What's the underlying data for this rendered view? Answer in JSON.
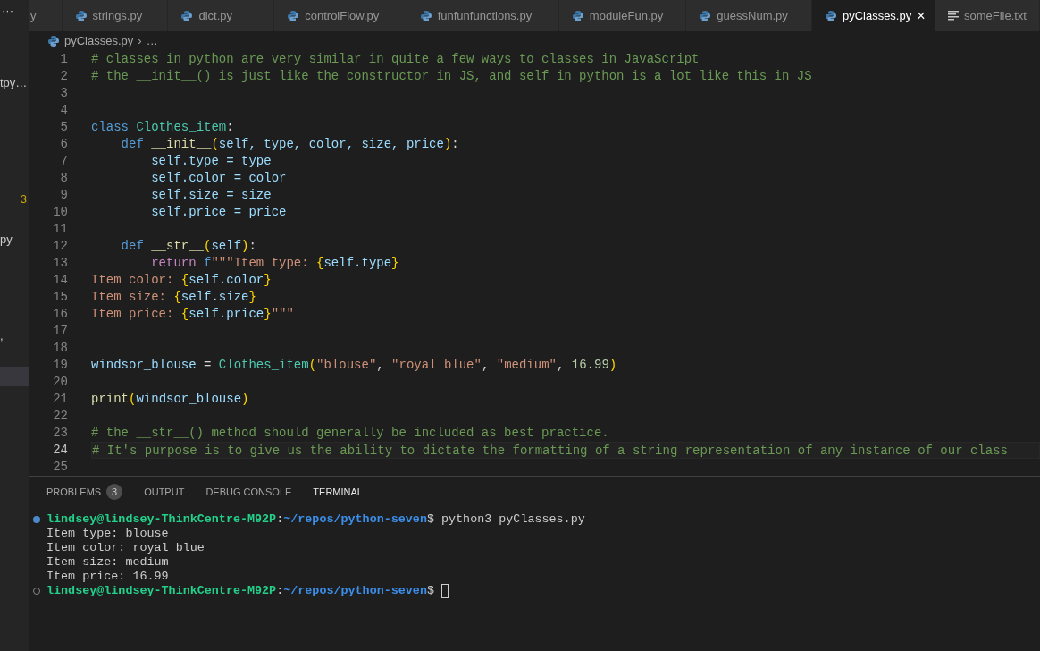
{
  "sidebar": {
    "more": "···",
    "items": [
      {
        "text": "tpy…",
        "kind": "file",
        "selected": false
      },
      {
        "text": "3",
        "kind": "count",
        "selected": false
      },
      {
        "text": "py",
        "kind": "file",
        "selected": false
      },
      {
        "text": ",",
        "kind": "file",
        "selected": false
      },
      {
        "kind": "file",
        "selected": true
      }
    ]
  },
  "tabs": [
    {
      "label": "y",
      "selected": false,
      "cut": true
    },
    {
      "label": "strings.py",
      "kind": "python",
      "selected": false
    },
    {
      "label": "dict.py",
      "kind": "python",
      "selected": false
    },
    {
      "label": "controlFlow.py",
      "kind": "python",
      "selected": false
    },
    {
      "label": "funfunfunctions.py",
      "kind": "python",
      "selected": false
    },
    {
      "label": "moduleFun.py",
      "kind": "python",
      "selected": false
    },
    {
      "label": "guessNum.py",
      "kind": "python",
      "selected": false
    },
    {
      "label": "pyClasses.py",
      "kind": "python",
      "selected": true,
      "close": "×"
    },
    {
      "label": "someFile.txt",
      "kind": "text",
      "selected": false
    }
  ],
  "breadcrumb": {
    "file": "pyClasses.py",
    "separator": "›",
    "more": "…"
  },
  "editor": {
    "lines": [
      {
        "number": "1",
        "current": false,
        "tokens": [
          {
            "kind": "comment",
            "text": "# classes in python are very similar in quite a few ways to classes in JavaScript"
          }
        ]
      },
      {
        "number": "2",
        "current": false,
        "tokens": [
          {
            "kind": "comment",
            "text": "# the __init__() is just like the constructor in JS, and self in python is a lot like this in JS"
          }
        ]
      },
      {
        "number": "3",
        "current": false
      },
      {
        "number": "4",
        "current": false
      },
      {
        "number": "5",
        "current": false,
        "tokens": [
          {
            "kind": "keyword",
            "text": "class "
          },
          {
            "kind": "class",
            "text": "Clothes_item"
          },
          {
            "kind": "plain",
            "text": ":"
          }
        ]
      },
      {
        "number": "6",
        "current": false,
        "tokens": [
          {
            "kind": "keyword",
            "text": "    def "
          },
          {
            "kind": "function",
            "text": "__init__"
          },
          {
            "kind": "bracket",
            "text": "("
          },
          {
            "kind": "variable",
            "text": "self, type, color, size, price"
          },
          {
            "kind": "bracket",
            "text": ")"
          },
          {
            "kind": "plain",
            "text": ":"
          }
        ]
      },
      {
        "number": "7",
        "current": false,
        "tokens": [
          {
            "kind": "variable",
            "text": "        self.type = type"
          }
        ]
      },
      {
        "number": "8",
        "current": false,
        "tokens": [
          {
            "kind": "variable",
            "text": "        self.color = color"
          }
        ]
      },
      {
        "number": "9",
        "current": false,
        "tokens": [
          {
            "kind": "variable",
            "text": "        self.size = size"
          }
        ]
      },
      {
        "number": "10",
        "current": false,
        "tokens": [
          {
            "kind": "variable",
            "text": "        self.price = price"
          }
        ]
      },
      {
        "number": "11",
        "current": false
      },
      {
        "number": "12",
        "current": false,
        "tokens": [
          {
            "kind": "keyword",
            "text": "    def "
          },
          {
            "kind": "function",
            "text": "__str__"
          },
          {
            "kind": "bracket",
            "text": "("
          },
          {
            "kind": "variable",
            "text": "self"
          },
          {
            "kind": "bracket",
            "text": ")"
          },
          {
            "kind": "plain",
            "text": ":"
          }
        ]
      },
      {
        "number": "13",
        "current": false,
        "tokens": [
          {
            "kind": "control",
            "text": "        return "
          },
          {
            "kind": "keyword",
            "text": "f"
          },
          {
            "kind": "string",
            "text": "\"\"\"Item type: "
          },
          {
            "kind": "bracket",
            "text": "{"
          },
          {
            "kind": "variable",
            "text": "self.type"
          },
          {
            "kind": "bracket",
            "text": "}"
          }
        ]
      },
      {
        "number": "14",
        "current": false,
        "tokens": [
          {
            "kind": "string",
            "text": "Item color: "
          },
          {
            "kind": "bracket",
            "text": "{"
          },
          {
            "kind": "variable",
            "text": "self.color"
          },
          {
            "kind": "bracket",
            "text": "}"
          }
        ]
      },
      {
        "number": "15",
        "current": false,
        "tokens": [
          {
            "kind": "string",
            "text": "Item size: "
          },
          {
            "kind": "bracket",
            "text": "{"
          },
          {
            "kind": "variable",
            "text": "self.size"
          },
          {
            "kind": "bracket",
            "text": "}"
          }
        ]
      },
      {
        "number": "16",
        "current": false,
        "tokens": [
          {
            "kind": "string",
            "text": "Item price: "
          },
          {
            "kind": "bracket",
            "text": "{"
          },
          {
            "kind": "variable",
            "text": "self.price"
          },
          {
            "kind": "bracket",
            "text": "}"
          },
          {
            "kind": "string",
            "text": "\"\"\""
          }
        ]
      },
      {
        "number": "17",
        "current": false
      },
      {
        "number": "18",
        "current": false
      },
      {
        "number": "19",
        "current": false,
        "tokens": [
          {
            "kind": "variable",
            "text": "windsor_blouse"
          },
          {
            "kind": "plain",
            "text": " = "
          },
          {
            "kind": "class",
            "text": "Clothes_item"
          },
          {
            "kind": "bracket",
            "text": "("
          },
          {
            "kind": "string",
            "text": "\"blouse\""
          },
          {
            "kind": "plain",
            "text": ", "
          },
          {
            "kind": "string",
            "text": "\"royal blue\""
          },
          {
            "kind": "plain",
            "text": ", "
          },
          {
            "kind": "string",
            "text": "\"medium\""
          },
          {
            "kind": "plain",
            "text": ", "
          },
          {
            "kind": "number",
            "text": "16.99"
          },
          {
            "kind": "bracket",
            "text": ")"
          }
        ]
      },
      {
        "number": "20",
        "current": false
      },
      {
        "number": "21",
        "current": false,
        "tokens": [
          {
            "kind": "function",
            "text": "print"
          },
          {
            "kind": "bracket",
            "text": "("
          },
          {
            "kind": "variable",
            "text": "windsor_blouse"
          },
          {
            "kind": "bracket",
            "text": ")"
          }
        ]
      },
      {
        "number": "22",
        "current": false
      },
      {
        "number": "23",
        "current": false,
        "tokens": [
          {
            "kind": "comment",
            "text": "# the __str__() method should generally be included as best practice."
          }
        ]
      },
      {
        "number": "24",
        "current": true,
        "tokens": [
          {
            "kind": "comment",
            "text": "# It's purpose is to give us the ability to dictate the formatting of a string representation of any instance of our class"
          }
        ]
      },
      {
        "number": "25",
        "current": false
      }
    ]
  },
  "panel": {
    "tabs": [
      {
        "label": "PROBLEMS",
        "badge": "3",
        "selected": false
      },
      {
        "label": "OUTPUT",
        "selected": false
      },
      {
        "label": "DEBUG CONSOLE",
        "selected": false
      },
      {
        "label": "TERMINAL",
        "selected": true
      }
    ],
    "terminal": [
      {
        "kind": "prompt",
        "ran": true,
        "user": "lindsey@lindsey-ThinkCentre-M92P",
        "colon": ":",
        "path": "~/repos/python-seven",
        "dollar": "$",
        "command": "python3 pyClasses.py",
        "cursor": false
      },
      {
        "kind": "output",
        "text": "Item type: blouse"
      },
      {
        "kind": "output",
        "text": "Item color: royal blue"
      },
      {
        "kind": "output",
        "text": "Item size: medium"
      },
      {
        "kind": "output",
        "text": "Item price: 16.99"
      },
      {
        "kind": "prompt",
        "ran": false,
        "user": "lindsey@lindsey-ThinkCentre-M92P",
        "colon": ":",
        "path": "~/repos/python-seven",
        "dollar": "$",
        "cursor": true
      }
    ]
  }
}
